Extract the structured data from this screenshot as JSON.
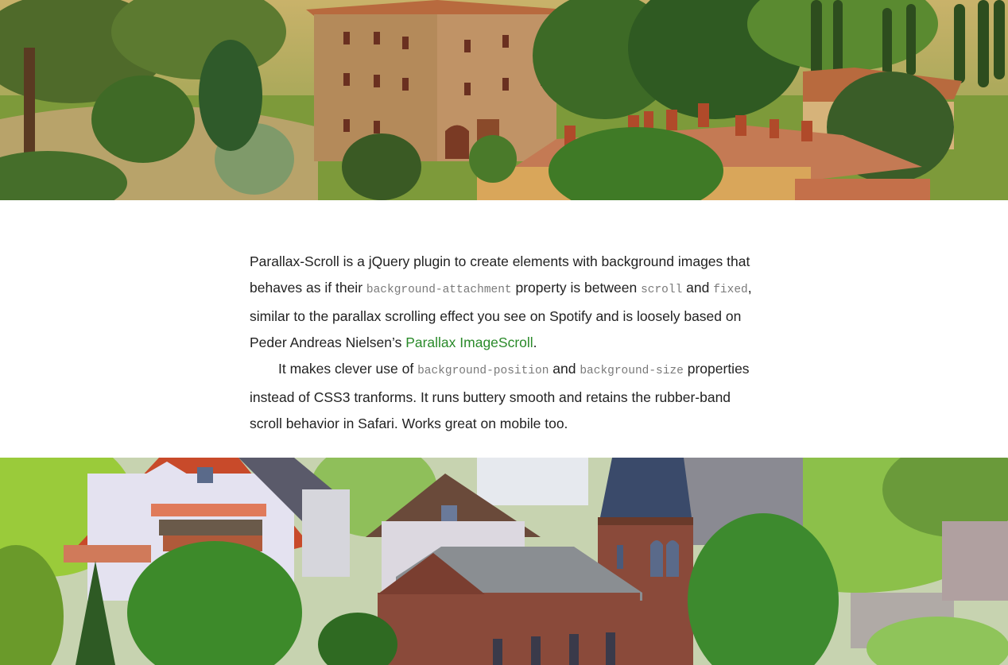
{
  "content": {
    "p1": {
      "t1": "Parallax-Scroll is a jQuery plugin to create elements with background images that behaves as if their ",
      "c1": "background-attachment",
      "t2": " property is between ",
      "c2": "scroll",
      "t3": " and ",
      "c3": "fixed",
      "t4": ", similar to the parallax scrolling effect you see on Spotify and is loosely based on Peder Andreas Nielsen’s ",
      "link": "Parallax ImageScroll",
      "t5": "."
    },
    "p2": {
      "t1": "It makes clever use of ",
      "c1": "background-position",
      "t2": " and ",
      "c2": "background-size",
      "t3": " properties instead of CSS3 tranforms. It runs buttery smooth and retains the rubber-band scroll behavior in Safari. Works great on mobile too."
    }
  },
  "colors": {
    "link": "#2a8a2a",
    "code": "#7a7a7a",
    "text": "#222222"
  },
  "images": {
    "top": "tuscan-villa-landscape-photo",
    "bottom": "village-church-tilt-shift-photo"
  }
}
